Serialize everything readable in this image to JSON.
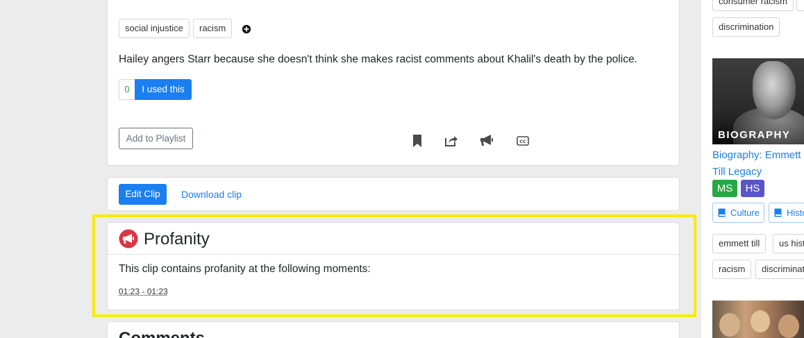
{
  "clip": {
    "tags": [
      "social injustice",
      "racism"
    ],
    "description": "Hailey angers Starr because she doesn't think she makes racist comments about Khalil's death by the police.",
    "used_count": "0",
    "used_label": "I used this",
    "playlist_label": "Add to Playlist"
  },
  "edit_bar": {
    "edit_label": "Edit Clip",
    "download_label": "Download clip"
  },
  "profanity": {
    "title": "Profanity",
    "text": "This clip contains profanity at the following moments:",
    "moments": [
      "01:23 - 01:23"
    ]
  },
  "comments": {
    "title": "Comments"
  },
  "sidebar": {
    "top_tags": [
      "consumer racism",
      "discrimination"
    ],
    "video": {
      "thumb_label": "BIOGRAPHY",
      "title": "Biography: Emmett Till Legacy",
      "grades": [
        "MS",
        "HS"
      ],
      "subjects": [
        "Culture",
        "History"
      ],
      "tags": [
        "emmett till",
        "us history",
        "racism",
        "discrimination"
      ]
    }
  },
  "colors": {
    "primary": "#1a7ff0",
    "ms_badge": "#28a745",
    "hs_badge": "#5a55c8",
    "profanity_icon": "#dc3545",
    "highlight": "#f7ec0a"
  }
}
